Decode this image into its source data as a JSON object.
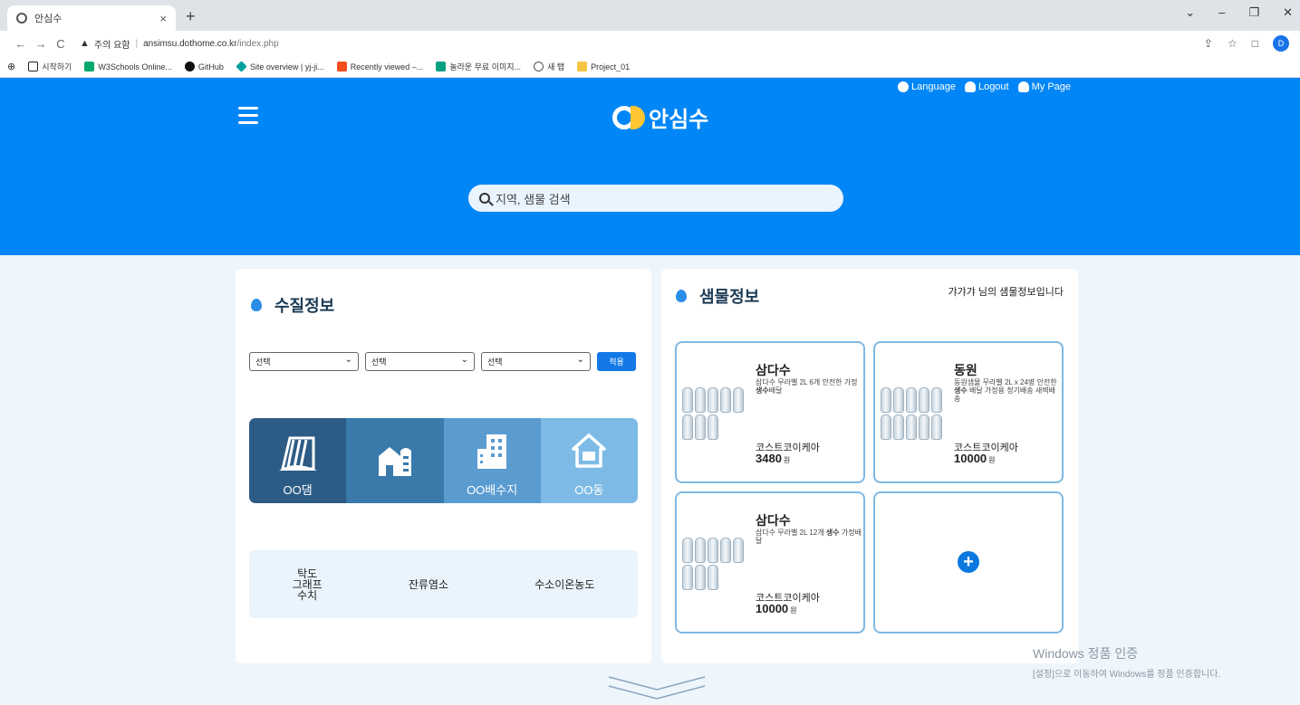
{
  "browser": {
    "tab_title": "안심수",
    "tab_close": "×",
    "new_tab": "+",
    "address_warning": "주의 요함",
    "address_sep": "|",
    "address_domain": "ansimsu.dothome.co.kr",
    "address_path": "/index.php",
    "nav_back": "←",
    "nav_forward": "→",
    "nav_reload": "C",
    "profile_initial": "D",
    "bookmarks": [
      {
        "label": "시작하기",
        "color": "#222222"
      },
      {
        "label": "W3Schools Online...",
        "color": "#04aa6d"
      },
      {
        "label": "GitHub",
        "color": "#111111"
      },
      {
        "label": "Site overview | yj-ji...",
        "color": "#00a0a0"
      },
      {
        "label": "Recently viewed –...",
        "color": "#f24e1e"
      },
      {
        "label": "놀라운 무료 이미지...",
        "color": "#05a081"
      },
      {
        "label": "새 탭",
        "color": "#555555"
      },
      {
        "label": "Project_01",
        "color": "#f4c542"
      }
    ]
  },
  "header": {
    "logo_text": "안심수",
    "top_links": [
      "Language",
      "Logout",
      "My Page"
    ],
    "search_placeholder": "지역, 샘물 검색",
    "bg_color": "#0086f6"
  },
  "water_quality": {
    "title": "수질정보",
    "selects": [
      "선택",
      "선택",
      "선택"
    ],
    "apply_label": "적용",
    "tiles": [
      {
        "label": "OO댐",
        "icon": "dam-icon"
      },
      {
        "label": "",
        "icon": "silo-icon"
      },
      {
        "label": "OO배수지",
        "icon": "building-icon"
      },
      {
        "label": "OO동",
        "icon": "house-icon"
      }
    ],
    "metrics": [
      "탁도\n그래프\n수치",
      "잔류염소",
      "수소이온농도"
    ],
    "metric_lines": [
      "탁도",
      "그래프",
      "수치"
    ]
  },
  "spring_water": {
    "title": "샘물정보",
    "owner_text": "갸갸갸 님의 샘물정보입니다",
    "products": [
      {
        "name": "삼다수",
        "desc_pre": "삼다수 무라벨 2L 6개 안전한 가정 ",
        "desc_bold": "생수",
        "desc_post": "배달",
        "seller": "코스트코이케아",
        "price": "3480",
        "unit": "원"
      },
      {
        "name": "동원",
        "desc_pre": "동원샘물 무라벨 2L x 24병 안전한 ",
        "desc_bold": "생수",
        "desc_post": " 배달 가정용 정기배송 새벽배송",
        "seller": "코스트코이케아",
        "price": "10000",
        "unit": "원"
      },
      {
        "name": "삼다수",
        "desc_pre": "삼다수 무라벨 2L 12개 ",
        "desc_bold": "생수",
        "desc_post": " 가정배달",
        "seller": "코스트코이케아",
        "price": "10000",
        "unit": "원"
      }
    ],
    "add_symbol": "+"
  },
  "watermark": {
    "line1": "Windows 정품 인증",
    "line2": "[설정]으로 이동하여 Windows를 정품 인증합니다."
  }
}
